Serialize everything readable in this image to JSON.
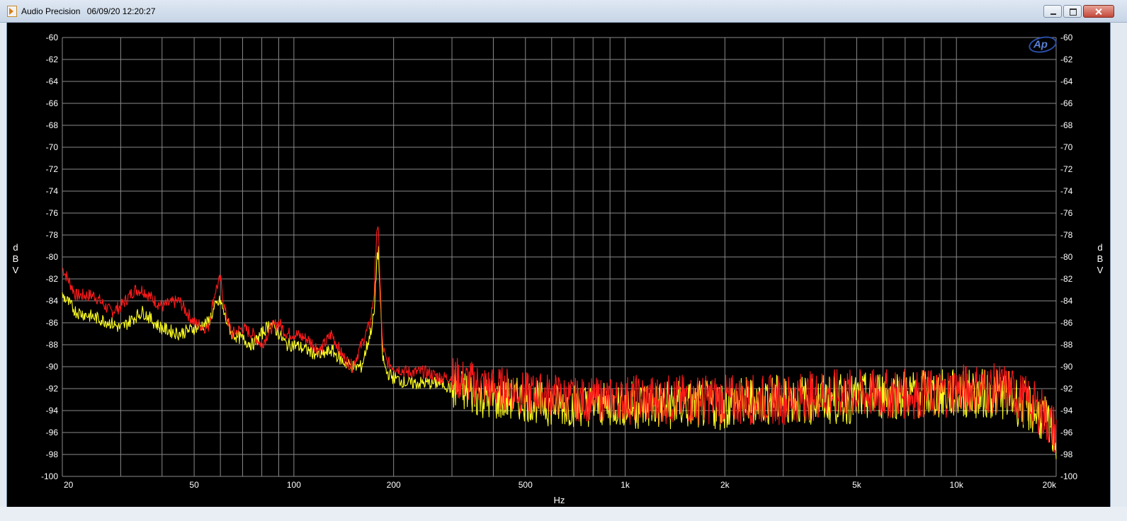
{
  "window": {
    "app_name": "Audio Precision",
    "timestamp": "06/09/20 12:20:27"
  },
  "logo": {
    "text": "Ap"
  },
  "chart_data": {
    "type": "line",
    "xlabel": "Hz",
    "ylabel": "dBV",
    "xscale": "log",
    "xlim": [
      20,
      20000
    ],
    "ylim": [
      -100,
      -60
    ],
    "grid": true,
    "x_tick_labels": [
      "20",
      "50",
      "100",
      "200",
      "500",
      "1k",
      "2k",
      "5k",
      "10k",
      "20k"
    ],
    "x_tick_values": [
      20,
      50,
      100,
      200,
      500,
      1000,
      2000,
      5000,
      10000,
      20000
    ],
    "y_ticks": [
      -60,
      -62,
      -64,
      -66,
      -68,
      -70,
      -72,
      -74,
      -76,
      -78,
      -80,
      -82,
      -84,
      -86,
      -88,
      -90,
      -92,
      -94,
      -96,
      -98,
      -100
    ],
    "colors": {
      "background": "#000000",
      "grid": "#8a8a8a",
      "axis_text": "#ffffff",
      "red_trace": "#ff1a1a",
      "yellow_trace": "#ffff22"
    },
    "series": [
      {
        "color": "#ff1a1a",
        "x": [
          20,
          22,
          25,
          28,
          30,
          33,
          35,
          38,
          40,
          45,
          50,
          55,
          58,
          60,
          62,
          65,
          70,
          75,
          80,
          85,
          90,
          95,
          100,
          110,
          120,
          130,
          140,
          150,
          160,
          170,
          175,
          178,
          180,
          183,
          185,
          190,
          200,
          220,
          250,
          280,
          300,
          350,
          400,
          450,
          500,
          600,
          700,
          800,
          900,
          1000,
          1200,
          1500,
          2000,
          2500,
          3000,
          4000,
          5000,
          6000,
          7000,
          8000,
          9000,
          10000,
          11000,
          12000,
          13000,
          14000,
          15000,
          16000,
          17000,
          18000,
          19000,
          19500,
          20000
        ],
        "y": [
          -81,
          -83.5,
          -83.5,
          -85,
          -84.5,
          -83,
          -83,
          -84,
          -84.5,
          -84,
          -86,
          -86.5,
          -83,
          -82,
          -85,
          -87,
          -86.5,
          -87,
          -88,
          -86.5,
          -86,
          -87,
          -87,
          -87.5,
          -88.5,
          -87,
          -89,
          -90,
          -88,
          -86,
          -83,
          -77,
          -78,
          -84,
          -88,
          -89.5,
          -90,
          -90.5,
          -90.5,
          -91,
          -91,
          -91.5,
          -92,
          -92,
          -92.5,
          -92.5,
          -93,
          -93,
          -93,
          -93,
          -93,
          -93,
          -93,
          -93,
          -93,
          -92.5,
          -92.5,
          -92.5,
          -92.5,
          -92.5,
          -92.5,
          -92,
          -92,
          -92,
          -92,
          -92,
          -92.5,
          -93,
          -93.5,
          -94,
          -95,
          -95.5,
          -96
        ]
      },
      {
        "color": "#ffff22",
        "x": [
          20,
          22,
          25,
          28,
          30,
          33,
          35,
          38,
          40,
          45,
          50,
          55,
          58,
          60,
          62,
          65,
          70,
          75,
          80,
          85,
          90,
          95,
          100,
          110,
          120,
          130,
          140,
          150,
          160,
          170,
          175,
          178,
          180,
          183,
          185,
          190,
          200,
          220,
          250,
          280,
          300,
          350,
          400,
          450,
          500,
          600,
          700,
          800,
          900,
          1000,
          1200,
          1500,
          2000,
          2500,
          3000,
          4000,
          5000,
          6000,
          7000,
          8000,
          9000,
          10000,
          11000,
          12000,
          13000,
          14000,
          15000,
          16000,
          17000,
          18000,
          19000,
          19500,
          20000
        ],
        "y": [
          -83.5,
          -85,
          -85.5,
          -86,
          -86.5,
          -85.5,
          -85,
          -86,
          -86.5,
          -87,
          -86.5,
          -86,
          -84.5,
          -84,
          -85.5,
          -87,
          -87.5,
          -88,
          -87,
          -86,
          -87,
          -88,
          -88,
          -88.5,
          -89,
          -88.5,
          -89.5,
          -90,
          -90,
          -87,
          -85,
          -80,
          -79.5,
          -85,
          -89,
          -90.5,
          -91,
          -91.5,
          -91.5,
          -91.5,
          -92,
          -92.5,
          -93,
          -93,
          -93,
          -93.5,
          -93.5,
          -93.5,
          -93.5,
          -93.5,
          -93.5,
          -93.5,
          -93.5,
          -93,
          -93,
          -93,
          -93,
          -92.5,
          -92.5,
          -92.5,
          -92.5,
          -92.5,
          -92.5,
          -92.5,
          -92.5,
          -92.5,
          -93,
          -93.5,
          -94,
          -94.5,
          -95.5,
          -96,
          -96.5
        ]
      }
    ]
  }
}
